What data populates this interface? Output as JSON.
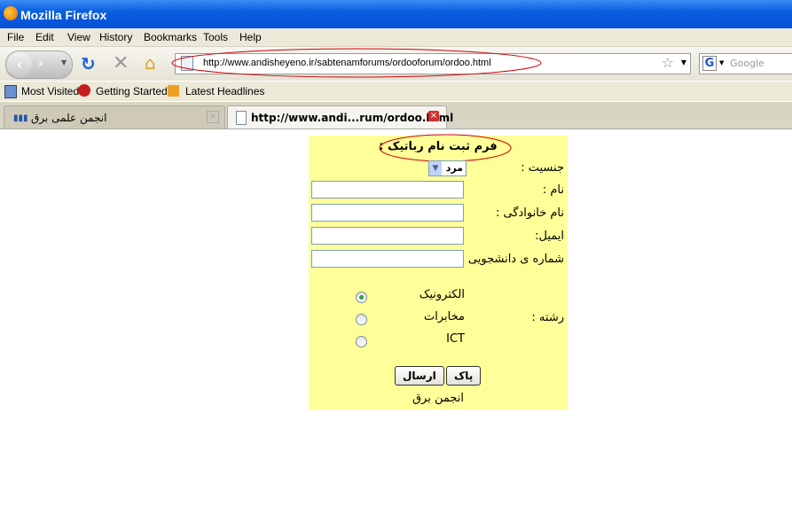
{
  "window": {
    "title": "Mozilla Firefox"
  },
  "menu": [
    "File",
    "Edit",
    "View",
    "History",
    "Bookmarks",
    "Tools",
    "Help"
  ],
  "navbar": {
    "url": "http://www.andisheyeno.ir/sabtenamforums/ordooforum/ordoo.html",
    "search_placeholder": "Google"
  },
  "bookmarks": [
    "Most Visited",
    "Getting Started",
    "Latest Headlines"
  ],
  "tabs": [
    {
      "label": "انجمن علمی برق",
      "active": false
    },
    {
      "label": "http://www.andi...rum/ordoo.html",
      "active": true
    }
  ],
  "form": {
    "title": "فرم ثبت نام رباتیک :",
    "gender_label": "جنسیت :",
    "gender_value": "مرد",
    "name_label": "نام :",
    "family_label": "نام خانوادگی :",
    "email_label": "ایمیل:",
    "student_id_label": "شماره ی دانشجویی :",
    "field_label": "رشته :",
    "field_options": [
      {
        "label": "الکترونیک",
        "checked": true
      },
      {
        "label": "مخابرات",
        "checked": false
      },
      {
        "label": "ICT",
        "checked": false
      }
    ],
    "reset_label": "پاک",
    "submit_label": "ارسال",
    "footer": "انجمن برق"
  },
  "colors": {
    "form_bg": "#ffff99",
    "annotation": "#cc0000"
  }
}
